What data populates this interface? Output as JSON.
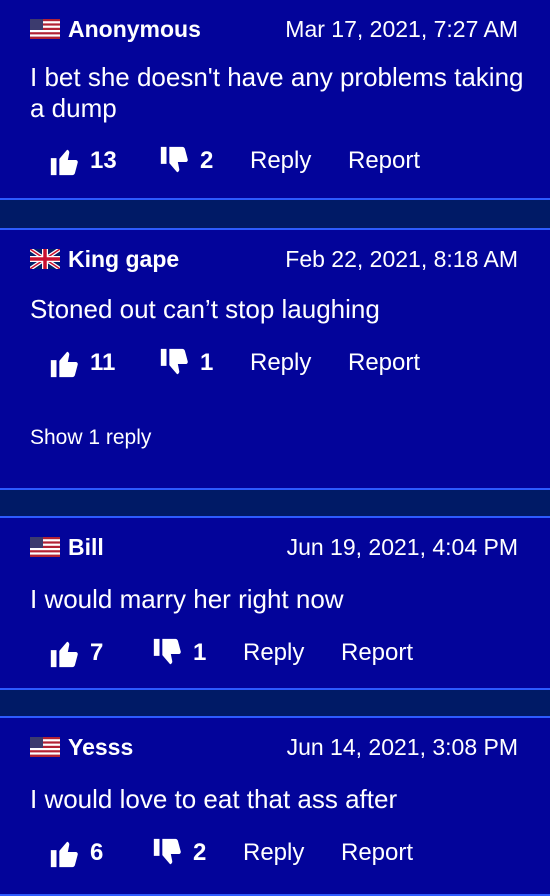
{
  "comments": [
    {
      "user": "Anonymous",
      "flag": "us-flag",
      "date": "Mar 17, 2021, 7:27 AM",
      "text": "I bet she doesn't have any problems taking a dump",
      "likes": "13",
      "dislikes": "2",
      "reply_label": "Reply",
      "report_label": "Report"
    },
    {
      "user": "King gape",
      "flag": "uk-flag",
      "date": "Feb 22, 2021, 8:18 AM",
      "text": "Stoned out can’t stop laughing",
      "likes": "11",
      "dislikes": "1",
      "reply_label": "Reply",
      "report_label": "Report",
      "show_replies": "Show 1 reply"
    },
    {
      "user": "Bill",
      "flag": "us-flag",
      "date": "Jun 19, 2021, 4:04 PM",
      "text": "I would marry her right now",
      "likes": "7",
      "dislikes": "1",
      "reply_label": "Reply",
      "report_label": "Report"
    },
    {
      "user": "Yesss",
      "flag": "us-flag",
      "date": "Jun 14, 2021, 3:08 PM",
      "text": "I would love to eat that ass after",
      "likes": "6",
      "dislikes": "2",
      "reply_label": "Reply",
      "report_label": "Report"
    }
  ],
  "colors": {
    "page_background": "#001a66",
    "card_background": "#03049a",
    "card_border": "#2d5bff",
    "text": "#ffffff"
  }
}
